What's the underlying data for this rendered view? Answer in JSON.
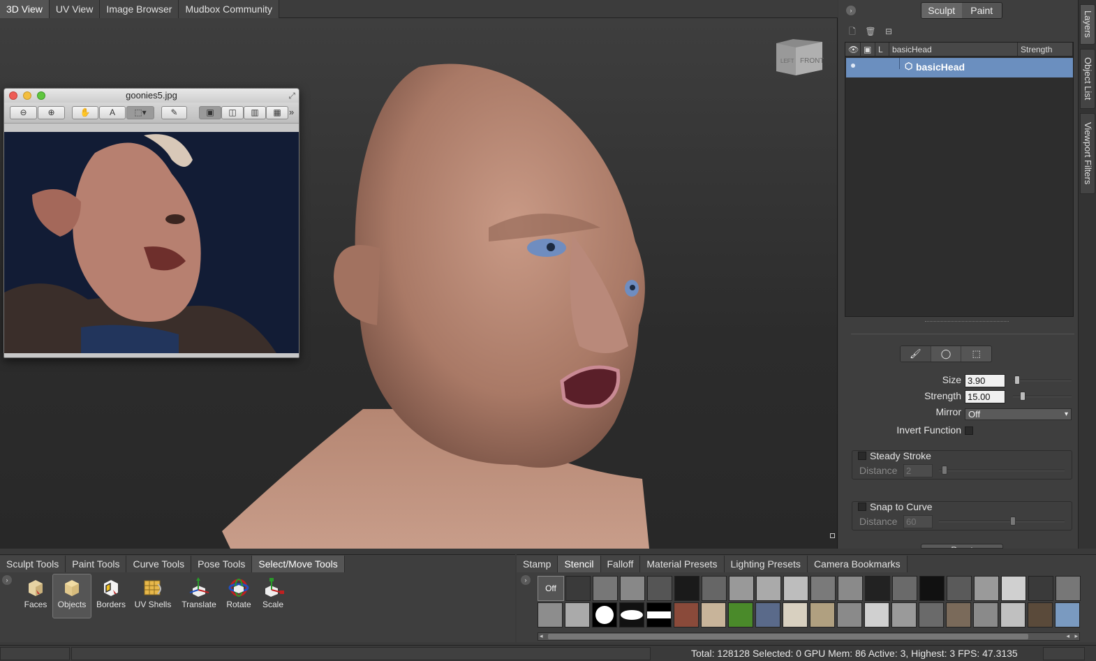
{
  "top_tabs": [
    "3D View",
    "UV View",
    "Image Browser",
    "Mudbox Community"
  ],
  "viewcube": {
    "left": "LEFT",
    "front": "FRONT"
  },
  "image_viewer": {
    "title": "goonies5.jpg"
  },
  "right_panel": {
    "mode_tabs": [
      "Sculpt",
      "Paint"
    ],
    "layers": {
      "headers": {
        "lock": "L",
        "name": "basicHead",
        "strength": "Strength"
      },
      "rows": [
        {
          "name": "basicHead"
        }
      ]
    },
    "props": {
      "size_label": "Size",
      "size_value": "3.90",
      "strength_label": "Strength",
      "strength_value": "15.00",
      "mirror_label": "Mirror",
      "mirror_value": "Off",
      "invert_label": "Invert Function",
      "steady_label": "Steady Stroke",
      "steady_distance_label": "Distance",
      "steady_distance_value": "2",
      "snap_label": "Snap to Curve",
      "snap_distance_label": "Distance",
      "snap_distance_value": "60",
      "reset_label": "Reset"
    },
    "side_tabs": [
      "Layers",
      "Object List",
      "Viewport Filters"
    ]
  },
  "tool_tabs": [
    "Sculpt Tools",
    "Paint Tools",
    "Curve Tools",
    "Pose Tools",
    "Select/Move Tools"
  ],
  "tools": [
    "Faces",
    "Objects",
    "Borders",
    "UV Shells",
    "Translate",
    "Rotate",
    "Scale"
  ],
  "stamp_tabs": [
    "Stamp",
    "Stencil",
    "Falloff",
    "Material Presets",
    "Lighting Presets",
    "Camera Bookmarks"
  ],
  "stencil_off_label": "Off",
  "status": {
    "text": "Total: 128128  Selected: 0 GPU Mem: 86  Active: 3, Highest: 3  FPS: 47.3135"
  }
}
